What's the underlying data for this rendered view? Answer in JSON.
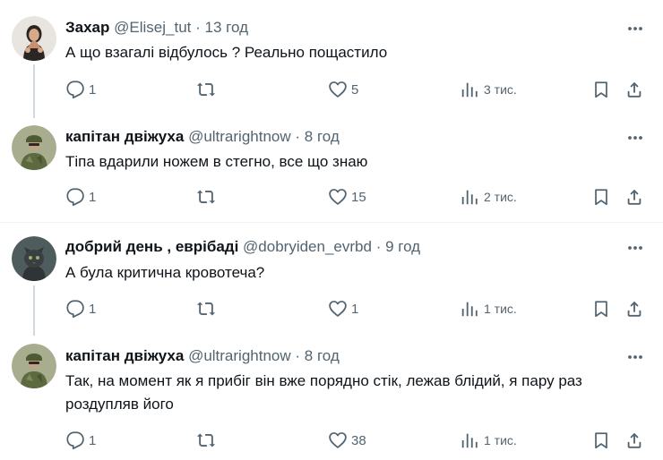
{
  "colors": {
    "text_primary": "#0f1419",
    "text_secondary": "#536471",
    "thread_line": "#cfd9de",
    "divider": "#eff3f4"
  },
  "tweets": [
    {
      "name": "Захар",
      "handle": "@Elisej_tut",
      "separator": "·",
      "time": "13 год",
      "text": "А що взагалі відбулось ? Реально пощастило",
      "replies": "1",
      "retweets": "",
      "likes": "5",
      "views": "3 тис.",
      "avatar_icon": "avatar-woman-icon"
    },
    {
      "name": "капітан двіжуха",
      "handle": "@ultrarightnow",
      "separator": "·",
      "time": "8 год",
      "text": "Тіпа вдарили ножем в стегно, все що знаю",
      "replies": "1",
      "retweets": "",
      "likes": "15",
      "views": "2 тис.",
      "avatar_icon": "avatar-soldier-icon"
    },
    {
      "name": "добрий день , еврібаді",
      "handle": "@dobryiden_evrbd",
      "separator": "·",
      "time": "9 год",
      "text": "А була критична кровотеча?",
      "replies": "1",
      "retweets": "",
      "likes": "1",
      "views": "1 тис.",
      "avatar_icon": "avatar-cat-icon"
    },
    {
      "name": "капітан двіжуха",
      "handle": "@ultrarightnow",
      "separator": "·",
      "time": "8 год",
      "text": "Так, на момент як я прибіг він вже порядно стік, лежав блідий, я пару раз роздупляв його",
      "replies": "1",
      "retweets": "",
      "likes": "38",
      "views": "1 тис.",
      "avatar_icon": "avatar-soldier-icon"
    }
  ]
}
